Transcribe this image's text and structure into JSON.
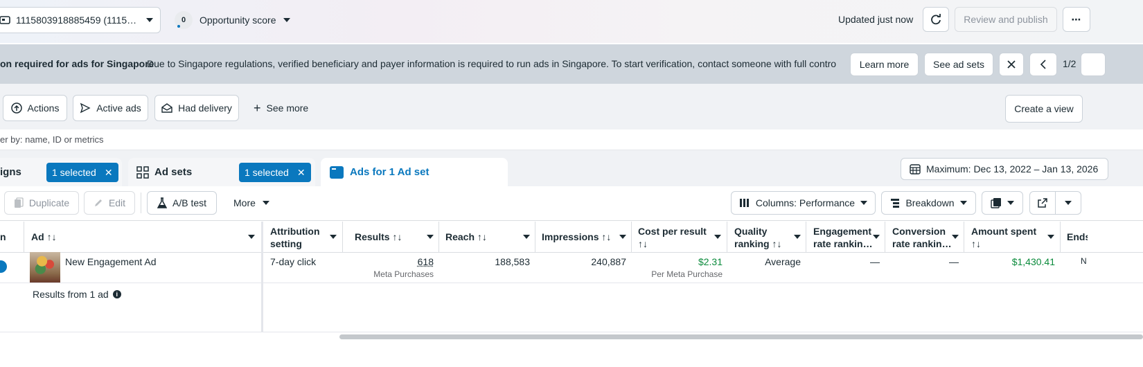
{
  "topbar": {
    "account_id": "1115803918885459 (1115…",
    "opportunity_count": "0",
    "opportunity_label": "Opportunity score",
    "updated": "Updated just now",
    "review_label": "Review and publish"
  },
  "banner": {
    "title": "on required for ads for Singapore",
    "message": "Due to Singapore regulations, verified beneficiary and payer information is required to run ads in Singapore. To start verification, contact someone with full control …",
    "learn_more": "Learn more",
    "see_ad_sets": "See ad sets",
    "pager": "1/2"
  },
  "filters": {
    "actions": "Actions",
    "active_ads": "Active ads",
    "had_delivery": "Had delivery",
    "see_more": "See more",
    "create_view": "Create a view"
  },
  "search": {
    "placeholder": "er by: name, ID or metrics"
  },
  "tabs": {
    "campaigns": "igns",
    "campaigns_chip": "1 selected",
    "adsets": "Ad sets",
    "adsets_chip": "1 selected",
    "ads": "Ads for 1 Ad set",
    "date_range": "Maximum: Dec 13, 2022 – Jan 13, 2026"
  },
  "toolbar": {
    "duplicate": "Duplicate",
    "edit": "Edit",
    "ab_test": "A/B test",
    "more": "More",
    "columns": "Columns: Performance",
    "breakdown": "Breakdown"
  },
  "table": {
    "headers": {
      "partial": "n",
      "ad": "Ad",
      "attribution_1": "Attribution",
      "attribution_2": "setting",
      "results": "Results",
      "reach": "Reach",
      "impressions": "Impressions",
      "cost_1": "Cost per result",
      "quality_1": "Quality",
      "quality_2": "ranking",
      "engagement_1": "Engagement",
      "engagement_2": "rate rankin…",
      "conversion_1": "Conversion",
      "conversion_2": "rate rankin…",
      "amount_1": "Amount spent",
      "ends": "Ends"
    },
    "row": {
      "ad_name": "New Engagement Ad",
      "attribution": "7-day click",
      "results": "618",
      "results_sub": "Meta Purchases",
      "reach": "188,583",
      "impressions": "240,887",
      "cost": "$2.31",
      "cost_sub": "Per Meta Purchase",
      "quality": "Average",
      "engagement": "—",
      "conversion": "—",
      "amount": "$1,430.41",
      "ends": "N"
    },
    "summary": "Results from 1 ad"
  },
  "colors": {
    "accent": "#0a78be",
    "positive": "#0a8a3b"
  }
}
